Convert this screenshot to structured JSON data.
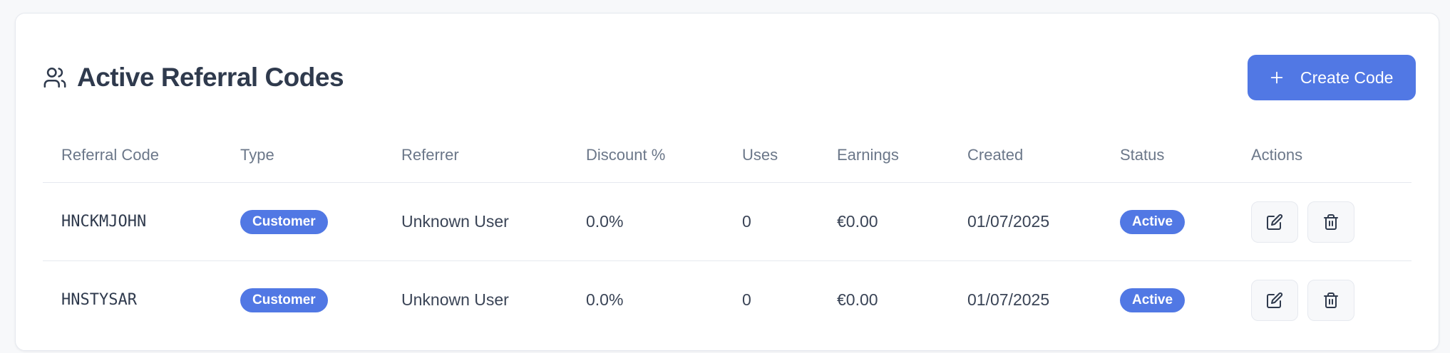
{
  "header": {
    "icon": "users-icon",
    "title": "Active Referral Codes",
    "create_button": {
      "icon": "plus-icon",
      "label": "Create Code"
    }
  },
  "table": {
    "columns": [
      "Referral Code",
      "Type",
      "Referrer",
      "Discount %",
      "Uses",
      "Earnings",
      "Created",
      "Status",
      "Actions"
    ],
    "rows": [
      {
        "code": "HNCKMJOHN",
        "type": "Customer",
        "referrer": "Unknown User",
        "discount": "0.0%",
        "uses": "0",
        "earnings": "€0.00",
        "created": "01/07/2025",
        "status": "Active"
      },
      {
        "code": "HNSTYSAR",
        "type": "Customer",
        "referrer": "Unknown User",
        "discount": "0.0%",
        "uses": "0",
        "earnings": "€0.00",
        "created": "01/07/2025",
        "status": "Active"
      }
    ],
    "row_actions": [
      "edit-icon",
      "trash-icon"
    ]
  },
  "colors": {
    "accent": "#5178e4",
    "border": "#e6e9ef",
    "title": "#2f3a4d",
    "muted": "#6b7789"
  }
}
